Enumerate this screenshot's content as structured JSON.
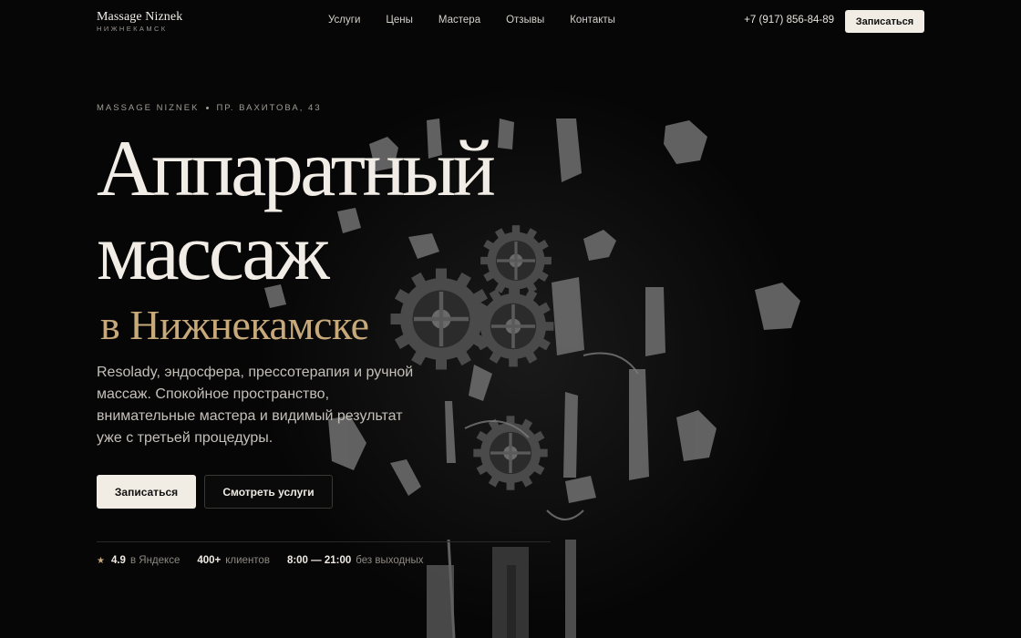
{
  "brand": {
    "name": "Massage Niznek",
    "city": "НИЖНЕКАМСК"
  },
  "nav": {
    "items": [
      "Услуги",
      "Цены",
      "Мастера",
      "Отзывы",
      "Контакты"
    ]
  },
  "header": {
    "phone": "+7 (917) 856-84-89",
    "cta_label": "Записаться"
  },
  "hero": {
    "eyebrow_brand": "MASSAGE NIZNEK",
    "eyebrow_address": "ПР. ВАХИТОВА, 43",
    "title_line1": "Аппаратный",
    "title_line2": "массаж",
    "title_city": "в Нижнекамске",
    "description": "Resolady, эндосфера, прессотерапия и ручной массаж. Спокойное пространство, внимательные мастера и видимый результат уже с третьей процедуры.",
    "primary_button": "Записаться",
    "secondary_button": "Смотреть услуги"
  },
  "stats": [
    {
      "value": "4.9",
      "label": "в Яндексе"
    },
    {
      "value": "400+",
      "label": "клиентов"
    },
    {
      "value": "8:00 — 21:00",
      "label": "без выходных"
    }
  ],
  "colors": {
    "background": "#060606",
    "accent_gold": "#c8a97a",
    "cream": "#f2ede4"
  },
  "icons": {
    "rating": "star-icon"
  }
}
